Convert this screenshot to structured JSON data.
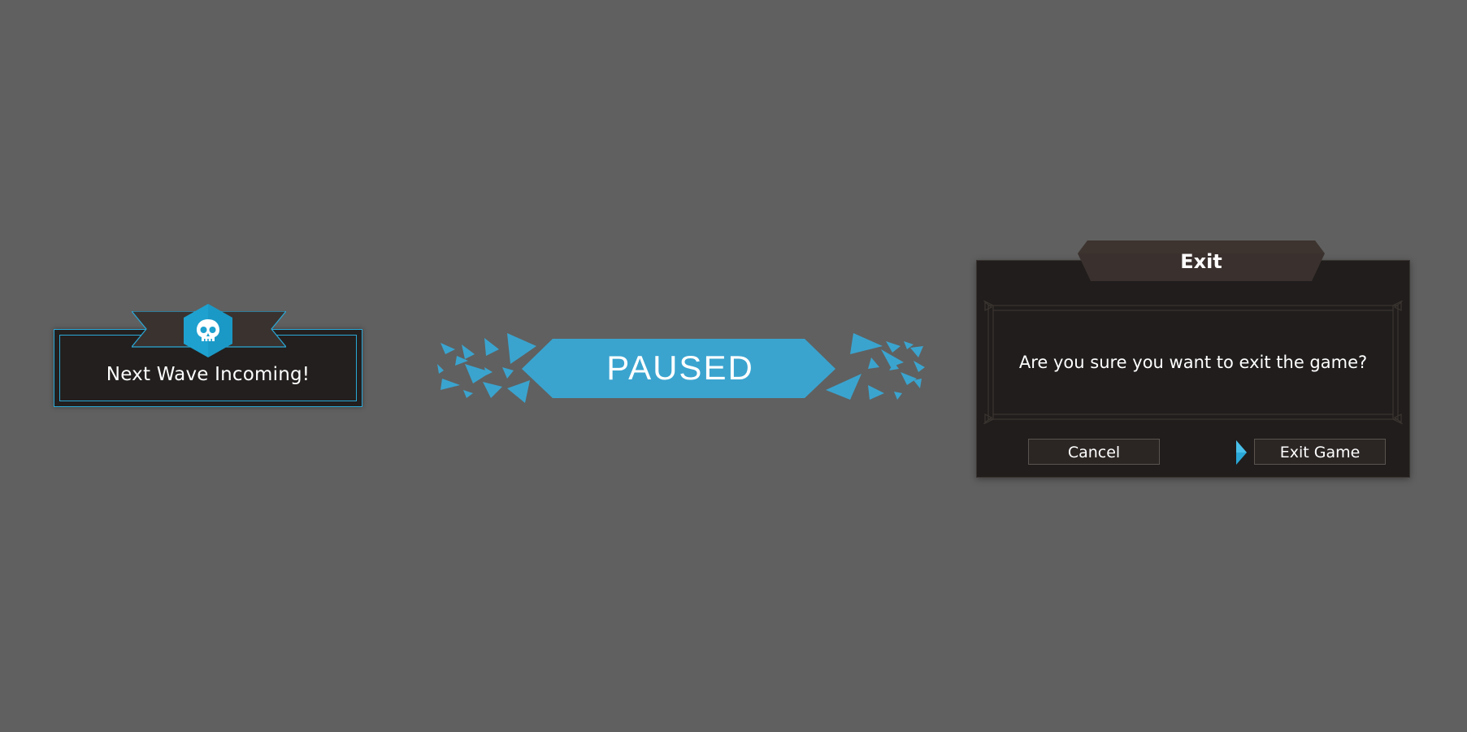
{
  "wave_notice": {
    "text": "Next Wave Incoming!",
    "icon": "skull-icon"
  },
  "pause_banner": {
    "label": "PAUSED"
  },
  "exit_dialog": {
    "title": "Exit",
    "message": "Are you sure you want to exit the game?",
    "cancel_label": "Cancel",
    "confirm_label": "Exit Game",
    "selected_button": "confirm"
  },
  "colors": {
    "background": "#606060",
    "accent_blue": "#2aa7d6",
    "panel_dark": "#221f1e",
    "ribbon_brown": "#3a322f",
    "banner_blue": "#3aa4cf"
  }
}
